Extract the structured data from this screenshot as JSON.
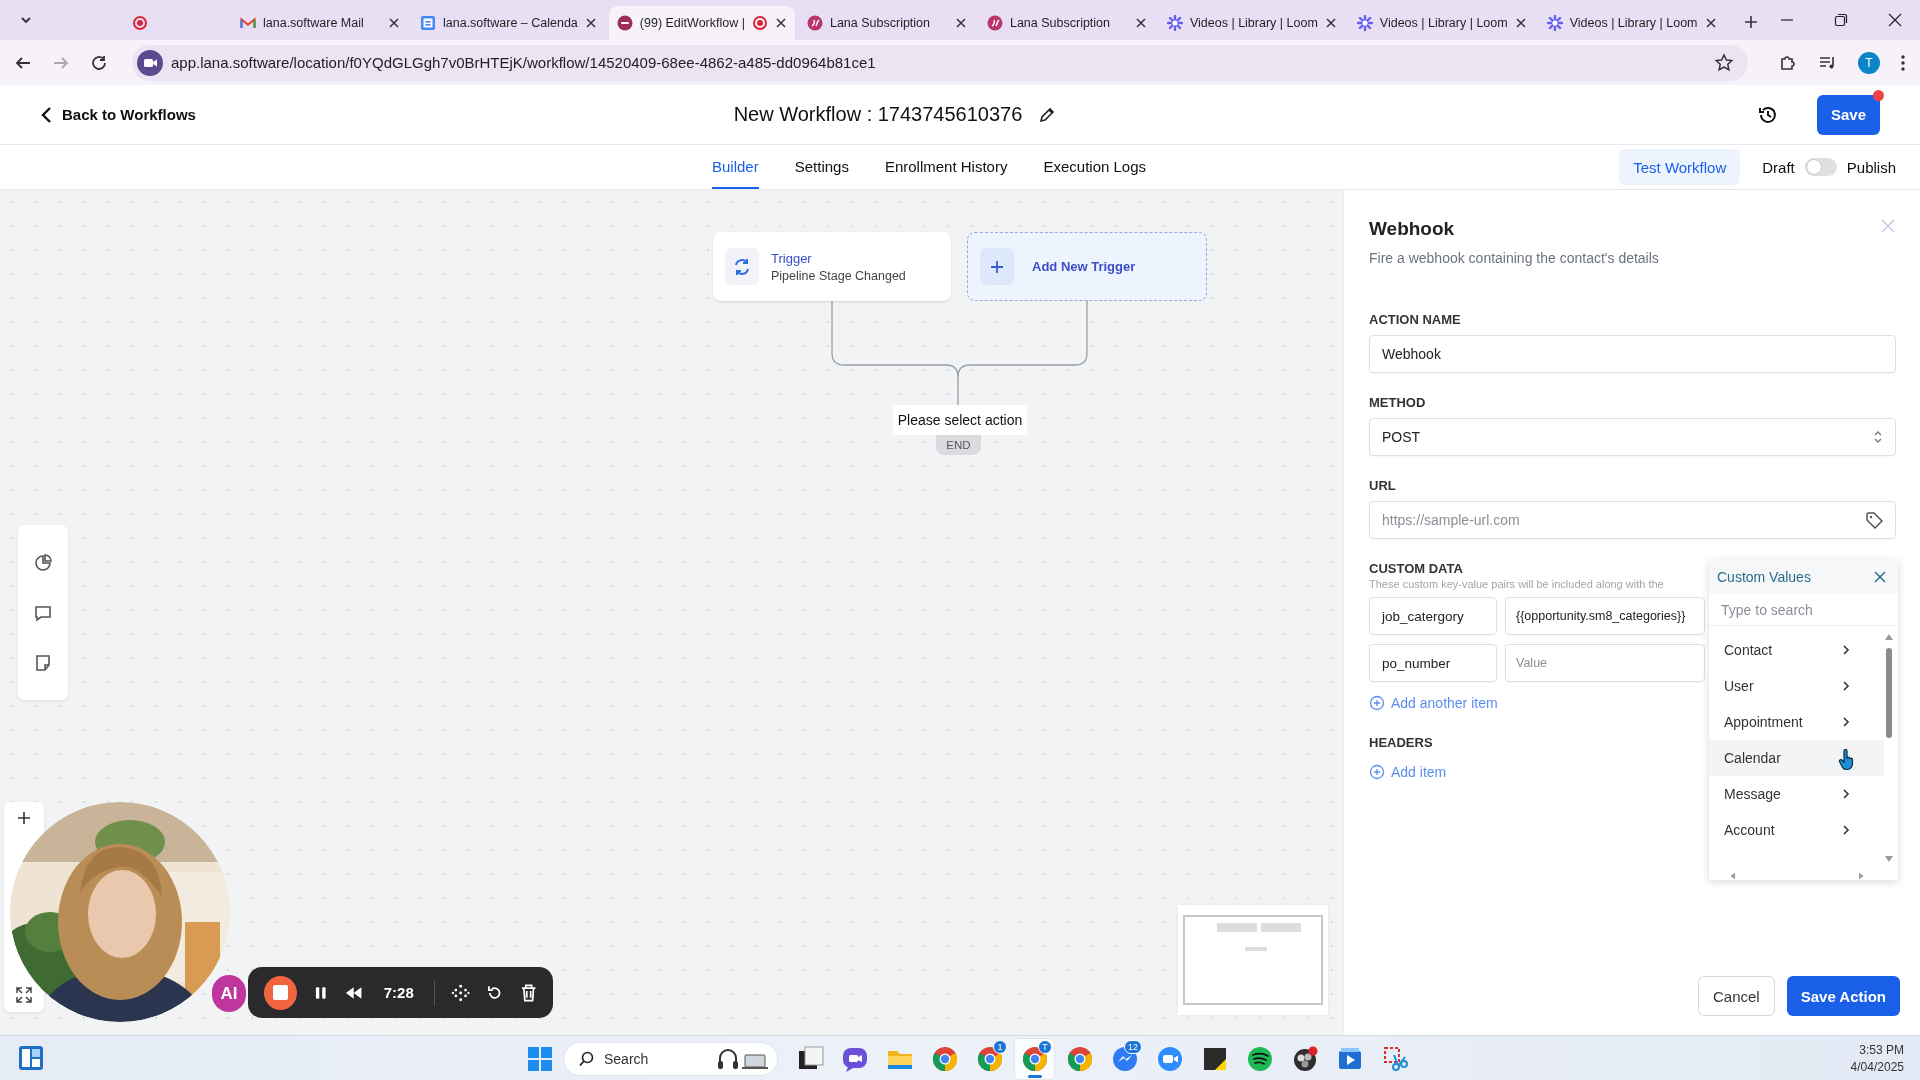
{
  "browser": {
    "tabs": [
      {
        "kind": "record",
        "recording": false,
        "selected": false
      },
      {
        "kind": "mail",
        "title": "lana.software Mail",
        "recording": false,
        "selected": false
      },
      {
        "kind": "calendar",
        "title": "lana.software – Calenda",
        "recording": false,
        "selected": false
      },
      {
        "kind": "app",
        "title": "(99) EditWorkflow |",
        "recording": true,
        "selected": true
      },
      {
        "kind": "lana",
        "title": "Lana Subscription",
        "recording": false,
        "selected": false
      },
      {
        "kind": "lana",
        "title": "Lana Subscription",
        "recording": false,
        "selected": false
      },
      {
        "kind": "loom",
        "title": "Videos | Library | Loom",
        "recording": false,
        "selected": false
      },
      {
        "kind": "loom",
        "title": "Videos | Library | Loom",
        "recording": false,
        "selected": false
      },
      {
        "kind": "loom",
        "title": "Videos | Library | Loom",
        "recording": false,
        "selected": false
      }
    ],
    "url": "app.lana.software/location/f0YQdGLGgh7v0BrHTEjK/workflow/14520409-68ee-4862-a485-dd0964b81ce1",
    "profile_initial": "T"
  },
  "header": {
    "back_label": "Back to Workflows",
    "title": "New Workflow : 1743745610376",
    "save_label": "Save",
    "unsaved": true
  },
  "nav": {
    "tabs": [
      {
        "label": "Builder",
        "selected": true
      },
      {
        "label": "Settings",
        "selected": false
      },
      {
        "label": "Enrollment History",
        "selected": false
      },
      {
        "label": "Execution Logs",
        "selected": false
      }
    ],
    "test_label": "Test Workflow",
    "draft_label": "Draft",
    "publish_on": false,
    "publish_label": "Publish"
  },
  "canvas": {
    "trigger": {
      "label": "Trigger",
      "detail": "Pipeline Stage Changed"
    },
    "add_trigger": "Add New Trigger",
    "action_prompt": "Please select action",
    "end_label": "END",
    "ai_label": "AI"
  },
  "recorder": {
    "time": "7:28"
  },
  "panel": {
    "title": "Webhook",
    "subtitle": "Fire a webhook containing the contact's details",
    "action_name": {
      "label": "ACTION NAME",
      "value": "Webhook"
    },
    "method": {
      "label": "METHOD",
      "value": "POST"
    },
    "url": {
      "label": "URL",
      "placeholder": "https://sample-url.com"
    },
    "custom_data": {
      "label": "CUSTOM DATA",
      "hint": "These custom key-value pairs will be included along with the",
      "rows": [
        {
          "key": "job_catergory",
          "value": "{{opportunity.sm8_categories}}"
        },
        {
          "key": "po_number",
          "placeholder": "Value"
        }
      ],
      "add_label": "Add another item"
    },
    "headers": {
      "label": "HEADERS",
      "add_label": "Add item"
    },
    "buttons": {
      "cancel": "Cancel",
      "save": "Save Action"
    }
  },
  "dropdown": {
    "title": "Custom Values",
    "placeholder": "Type to search",
    "items": [
      {
        "label": "Contact",
        "selected": false
      },
      {
        "label": "User",
        "selected": false
      },
      {
        "label": "Appointment",
        "selected": false
      },
      {
        "label": "Calendar",
        "selected": true
      },
      {
        "label": "Message",
        "selected": false
      },
      {
        "label": "Account",
        "selected": false
      }
    ]
  },
  "taskbar": {
    "search_placeholder": "Search",
    "apps": [
      {
        "kind": "taskview",
        "active": false
      },
      {
        "kind": "chat",
        "active": false
      },
      {
        "kind": "folder",
        "active": false
      },
      {
        "kind": "chrome",
        "active": false
      },
      {
        "kind": "chrome",
        "badge": "1",
        "active": false
      },
      {
        "kind": "chrome",
        "badge": "T",
        "active": true
      },
      {
        "kind": "chrome",
        "active": false
      },
      {
        "kind": "messenger",
        "badge": "12",
        "active": false
      },
      {
        "kind": "zoom",
        "active": false
      },
      {
        "kind": "sticky",
        "active": false
      },
      {
        "kind": "spotify",
        "active": false
      },
      {
        "kind": "obs",
        "active": false
      },
      {
        "kind": "video",
        "active": false
      },
      {
        "kind": "snip",
        "active": false
      }
    ],
    "time": "3:53 PM",
    "date": "4/04/2025"
  }
}
